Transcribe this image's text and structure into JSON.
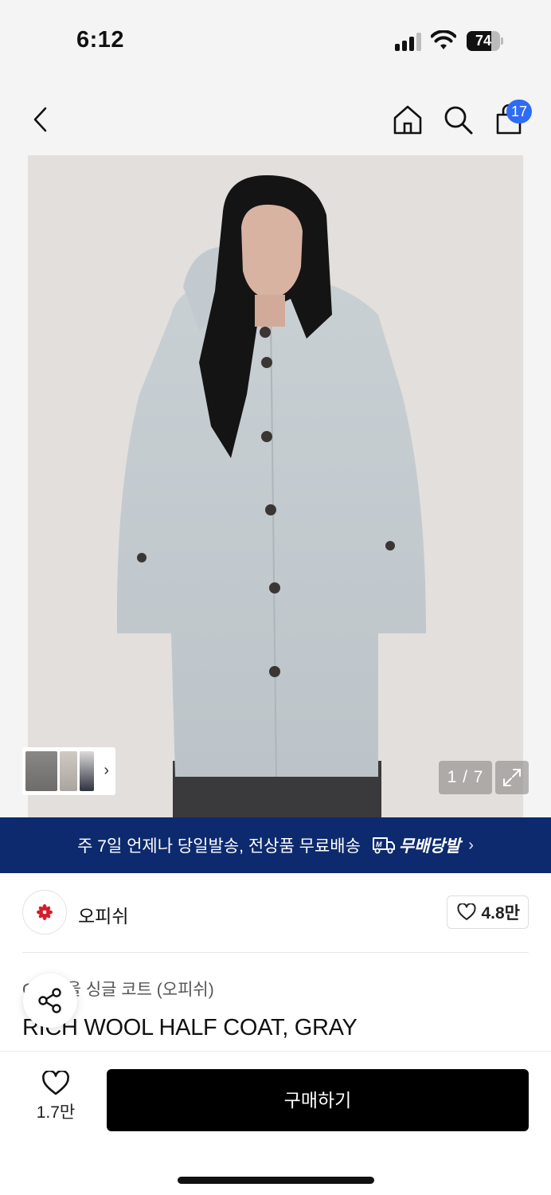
{
  "status_bar": {
    "time": "6:12",
    "battery_level": "74",
    "battery_fraction": 0.74
  },
  "nav": {
    "back_icon": "chevron-left-icon",
    "home_icon": "home-icon",
    "search_icon": "search-icon",
    "cart_icon": "shopping-bag-icon",
    "cart_count": "17"
  },
  "gallery": {
    "counter": "1 / 7",
    "current_index": 1,
    "total": 7,
    "expand_icon": "expand-icon",
    "thumb_arrow_icon": "chevron-right-icon"
  },
  "banner": {
    "text": "주 7일 언제나 당일발송, 전상품 무료배송",
    "logo_text": "무배당발",
    "chevron_icon": "chevron-right-icon"
  },
  "brand": {
    "name": "오피쉬",
    "logo_icon": "flower-icon",
    "like_count": "4.8만",
    "like_icon": "heart-icon"
  },
  "product": {
    "breadcrumb": [
      "O",
      "겨울 싱글 코트 (오피쉬)"
    ],
    "title": "RICH WOOL HALF COAT, GRAY",
    "share_icon": "share-icon"
  },
  "bottom_bar": {
    "like_count": "1.7만",
    "like_icon": "heart-icon",
    "buy_label": "구매하기"
  },
  "colors": {
    "banner_bg": "#0d2a6e",
    "badge_blue": "#2e6cf6",
    "buy_button_bg": "#000000",
    "brand_logo_red": "#d21f2b"
  }
}
